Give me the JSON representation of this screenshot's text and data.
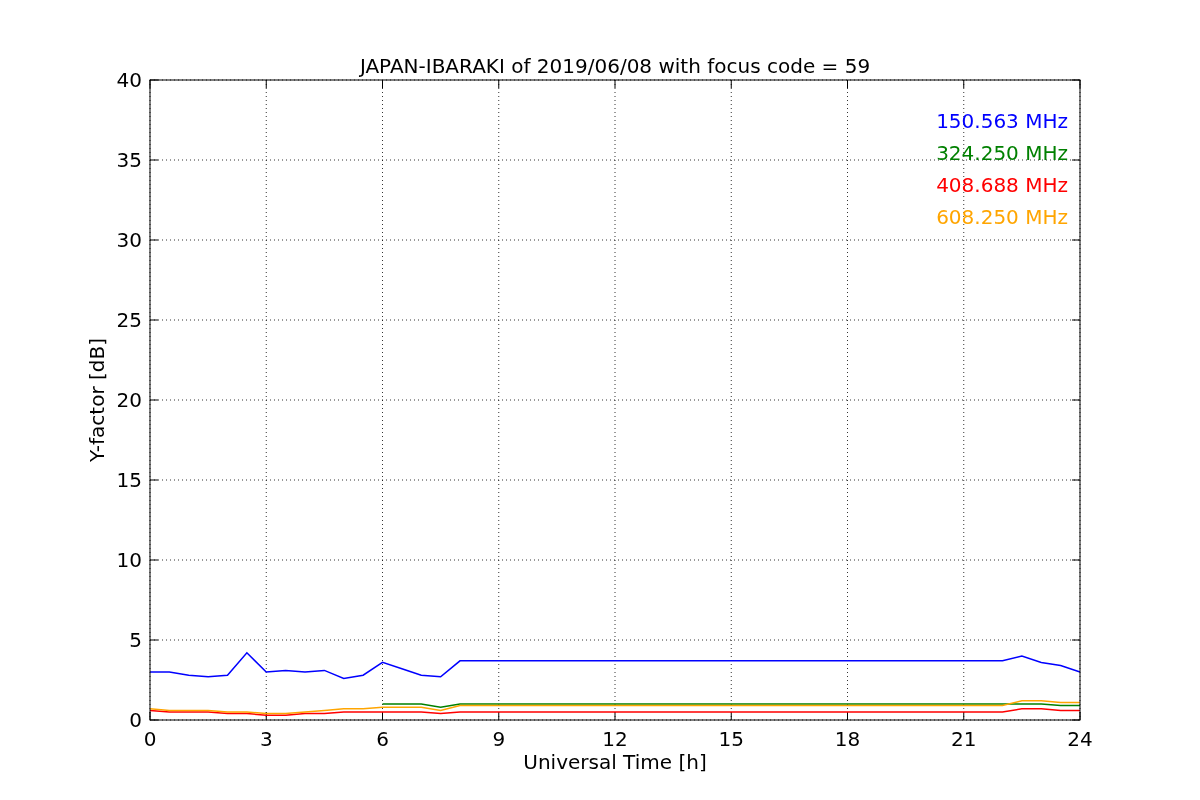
{
  "chart": {
    "chart_data": {
      "type": "line",
      "title": "JAPAN-IBARAKI of 2019/06/08 with focus code = 59",
      "xlabel": "Universal Time [h]",
      "ylabel": "Y-factor [dB]",
      "x": [
        0,
        0.5,
        1,
        1.5,
        2,
        2.5,
        3,
        3.5,
        4,
        4.5,
        5,
        5.5,
        6,
        6.5,
        7,
        7.5,
        8,
        22,
        22.5,
        23,
        23.5,
        24
      ],
      "xlim": [
        0,
        24
      ],
      "ylim": [
        0,
        40
      ],
      "xticks": [
        0,
        3,
        6,
        9,
        12,
        15,
        18,
        21,
        24
      ],
      "yticks": [
        0,
        5,
        10,
        15,
        20,
        25,
        30,
        35,
        40
      ],
      "grid": true,
      "series": [
        {
          "name": "150.563 MHz",
          "color": "#0000ff",
          "values": [
            3.0,
            3.0,
            2.8,
            2.7,
            2.8,
            4.2,
            3.0,
            3.1,
            3.0,
            3.1,
            2.6,
            2.8,
            3.6,
            3.2,
            2.8,
            2.7,
            3.7,
            3.7,
            4.0,
            3.6,
            3.4,
            3.0
          ]
        },
        {
          "name": "324.250 MHz",
          "color": "#008000",
          "values": [
            null,
            null,
            null,
            null,
            null,
            null,
            null,
            null,
            null,
            null,
            null,
            null,
            1.0,
            1.0,
            1.0,
            0.8,
            1.0,
            1.0,
            1.0,
            1.0,
            0.9,
            0.9
          ]
        },
        {
          "name": "408.688 MHz",
          "color": "#ff0000",
          "values": [
            0.6,
            0.5,
            0.5,
            0.5,
            0.4,
            0.4,
            0.3,
            0.3,
            0.4,
            0.4,
            0.5,
            0.5,
            0.5,
            0.5,
            0.5,
            0.4,
            0.5,
            0.5,
            0.7,
            0.7,
            0.6,
            0.6
          ]
        },
        {
          "name": "608.250 MHz",
          "color": "#ffa500",
          "values": [
            0.7,
            0.6,
            0.6,
            0.6,
            0.5,
            0.5,
            0.4,
            0.4,
            0.5,
            0.6,
            0.7,
            0.7,
            0.8,
            0.8,
            0.8,
            0.6,
            0.9,
            0.9,
            1.2,
            1.2,
            1.1,
            1.1
          ]
        }
      ]
    }
  }
}
